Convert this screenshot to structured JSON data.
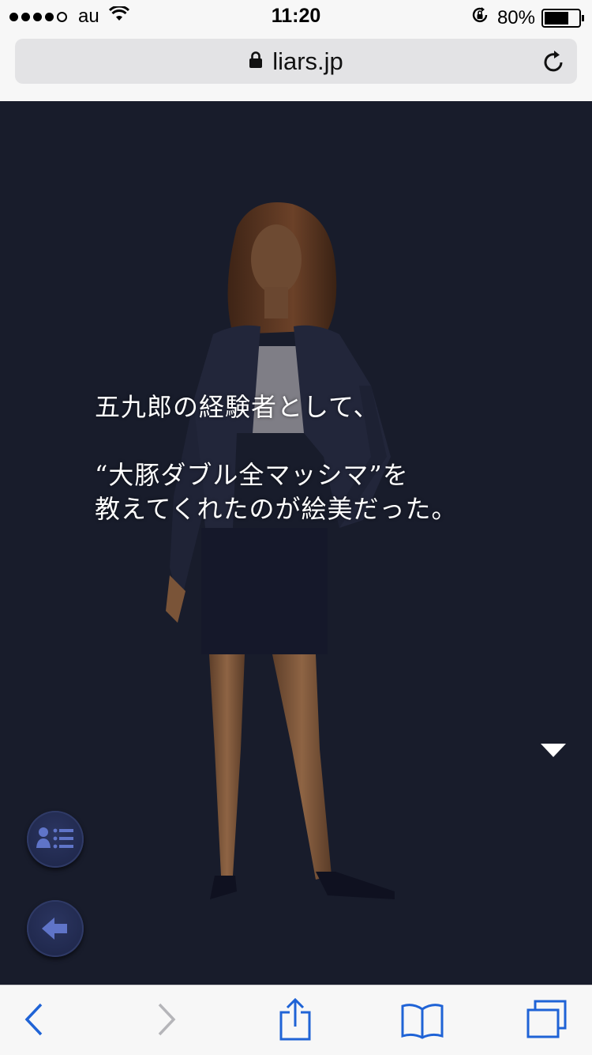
{
  "status_bar": {
    "carrier": "au",
    "time": "11:20",
    "battery_percent": "80%",
    "battery_level": 0.8,
    "signal_bars": 4,
    "signal_bars_total": 5
  },
  "browser": {
    "url": "liars.jp"
  },
  "dialogue": {
    "line1": "五九郎の経験者として、",
    "line2": "“大豚ダブル全マッシマ”を",
    "line3": "教えてくれたのが絵美だった。"
  },
  "icons": {
    "lock": "lock-icon",
    "reload": "reload-icon",
    "next": "next-triangle-icon",
    "log": "log-list-icon",
    "back": "back-arrow-icon",
    "nav_back": "chevron-left-icon",
    "nav_forward": "chevron-right-icon",
    "share": "share-icon",
    "bookmarks": "book-icon",
    "tabs": "tabs-icon"
  },
  "colors": {
    "stage_bg": "#181c2b",
    "ios_blue": "#1f63d6",
    "button_icon": "#5f74c8"
  }
}
